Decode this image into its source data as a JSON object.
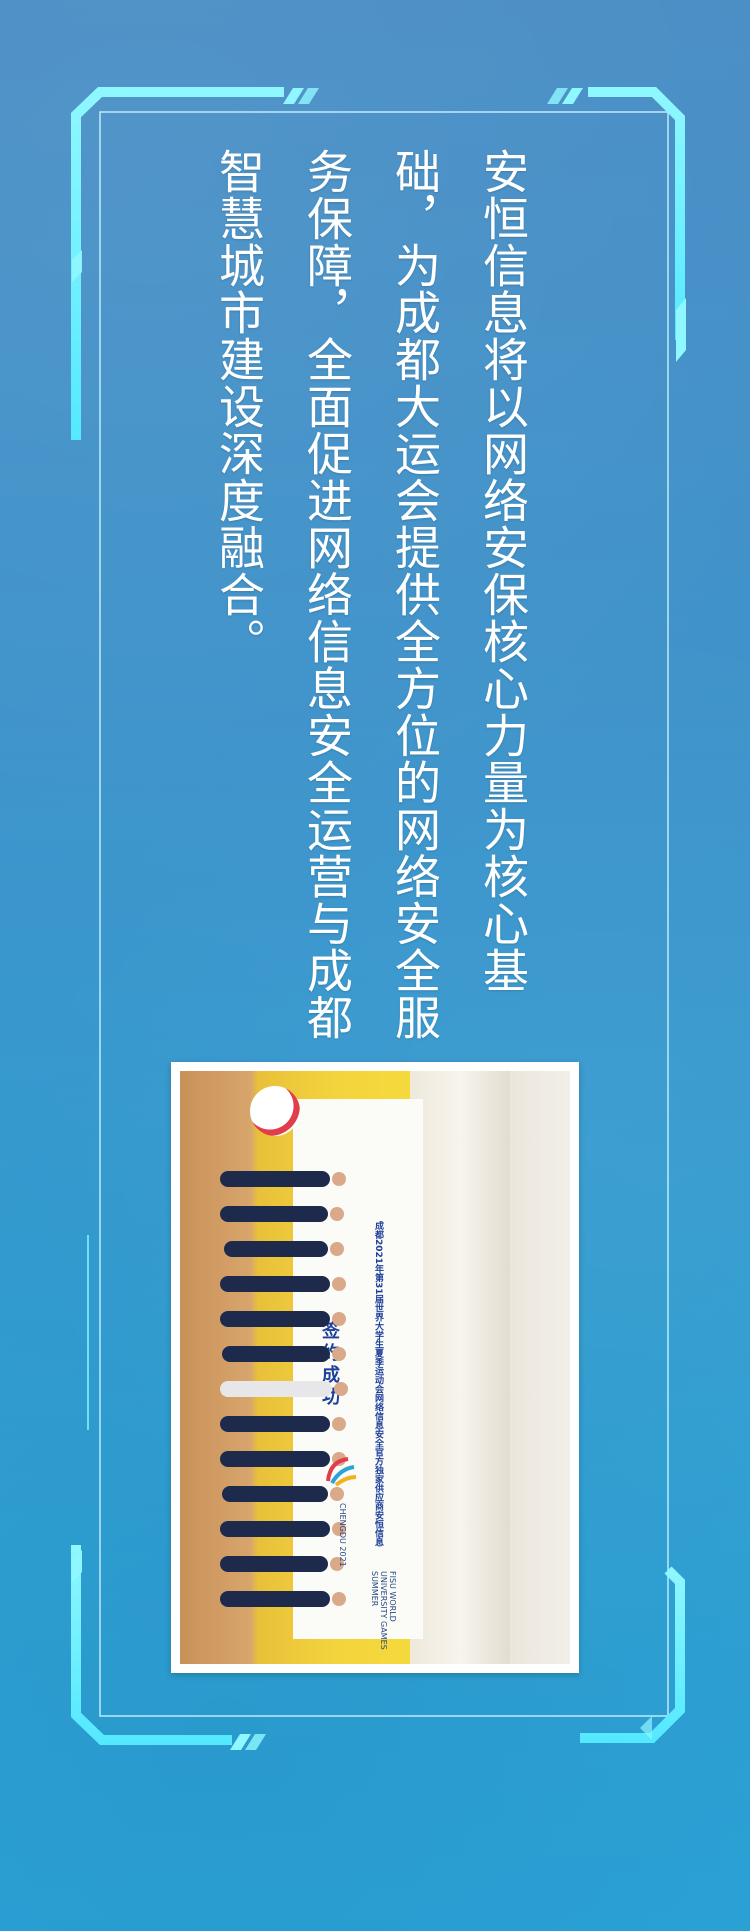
{
  "main_text": "安恒信息将以网络安保核心力量为核心基础，为成都大运会提供全方位的网络安全服务保障，全面促进网络信息安全运营与成都智慧城市建设深度融合。",
  "photo": {
    "banner_title": "成都2021年第31届世界大学生夏季运动会网络信息安全官方独家供应商安恒信息",
    "banner_sign": "签约成功",
    "event_logo_text": "CHENGDU 2021",
    "fisu_text": "FISU WORLD UNIVERSITY GAMES SUMMER"
  },
  "colors": {
    "frame": "#7ff5ff",
    "frame_inner": "#c8f7ff",
    "text": "#ffffff"
  }
}
